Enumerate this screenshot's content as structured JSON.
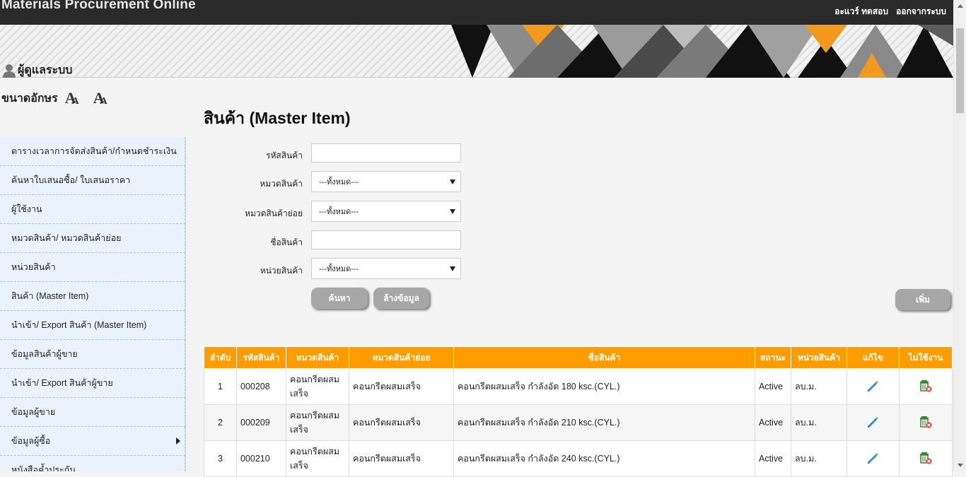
{
  "header": {
    "app_title": "Materials Procurement Online",
    "user_name": "อะแวร์ ทดสอบ",
    "logout_label": "ออกจากระบบ"
  },
  "role_title": "ผู้ดูแลระบบ",
  "font_size": {
    "label": "ขนาดอักษร",
    "increase_glyph": "A",
    "decrease_glyph": "A"
  },
  "sidebar": {
    "items": [
      {
        "label": "ตารางเวลาการจัดส่งสินค้า/กำหนดชำระเงิน"
      },
      {
        "label": "ค้นหาใบเสนอซื้อ/ ใบเสนอราคา"
      },
      {
        "label": "ผู้ใช้งาน"
      },
      {
        "label": "หมวดสินค้า/ หมวดสินค้าย่อย"
      },
      {
        "label": "หน่วยสินค้า"
      },
      {
        "label": "สินค้า (Master Item)"
      },
      {
        "label": "นำเข้า/ Export สินค้า (Master Item)"
      },
      {
        "label": "ข้อมูลสินค้าผู้ขาย"
      },
      {
        "label": "นำเข้า/ Export สินค้าผู้ขาย"
      },
      {
        "label": "ข้อมูลผู้ขาย"
      },
      {
        "label": "ข้อมูลผู้ซื้อ",
        "has_submenu": true
      },
      {
        "label": "หนังสือค้ำประกัน"
      }
    ]
  },
  "page_title": "สินค้า (Master Item)",
  "search_form": {
    "code_label": "รหัสสินค้า",
    "code_value": "",
    "category_label": "หมวดสินค้า",
    "category_value": "---ทั้งหมด---",
    "subcategory_label": "หมวดสินค้าย่อย",
    "subcategory_value": "---ทั้งหมด---",
    "name_label": "ชื่อสินค้า",
    "name_value": "",
    "unit_label": "หน่วยสินค้า",
    "unit_value": "---ทั้งหมด---",
    "search_button": "ค้นหา",
    "clear_button": "ล้างข้อมูล",
    "add_button": "เพิ่ม"
  },
  "table": {
    "columns": [
      "ลำดับ",
      "รหัสสินค้า",
      "หมวดสินค้า",
      "หมวดสินค้าย่อย",
      "ชื่อสินค้า",
      "สถานะ",
      "หน่วยสินค้า",
      "แก้ไข",
      "ไม่ใช้งาน"
    ],
    "rows": [
      {
        "no": "1",
        "code": "000208",
        "category": "คอนกรีตผสมเสร็จ",
        "subcategory": "คอนกรีตผสมเสร็จ",
        "name": "คอนกรีตผสมเสร็จ กำลังอัด 180 ksc.(CYL.)",
        "status": "Active",
        "unit": "ลบ.ม."
      },
      {
        "no": "2",
        "code": "000209",
        "category": "คอนกรีตผสมเสร็จ",
        "subcategory": "คอนกรีตผสมเสร็จ",
        "name": "คอนกรีตผสมเสร็จ กำลังอัด 210 ksc.(CYL.)",
        "status": "Active",
        "unit": "ลบ.ม."
      },
      {
        "no": "3",
        "code": "000210",
        "category": "คอนกรีตผสมเสร็จ",
        "subcategory": "คอนกรีตผสมเสร็จ",
        "name": "คอนกรีตผสมเสร็จ กำลังอัด 240 ksc.(CYL.)",
        "status": "Active",
        "unit": "ลบ.ม."
      }
    ]
  },
  "colors": {
    "topbar": "#2a2a2a",
    "table_header": "#ff9c00",
    "sidebar_item_bg": "#eaf3fc",
    "button_gray": "#a7a7a7"
  },
  "icons": {
    "user": "user-icon",
    "edit": "pencil-icon",
    "disable": "trash-icon"
  }
}
